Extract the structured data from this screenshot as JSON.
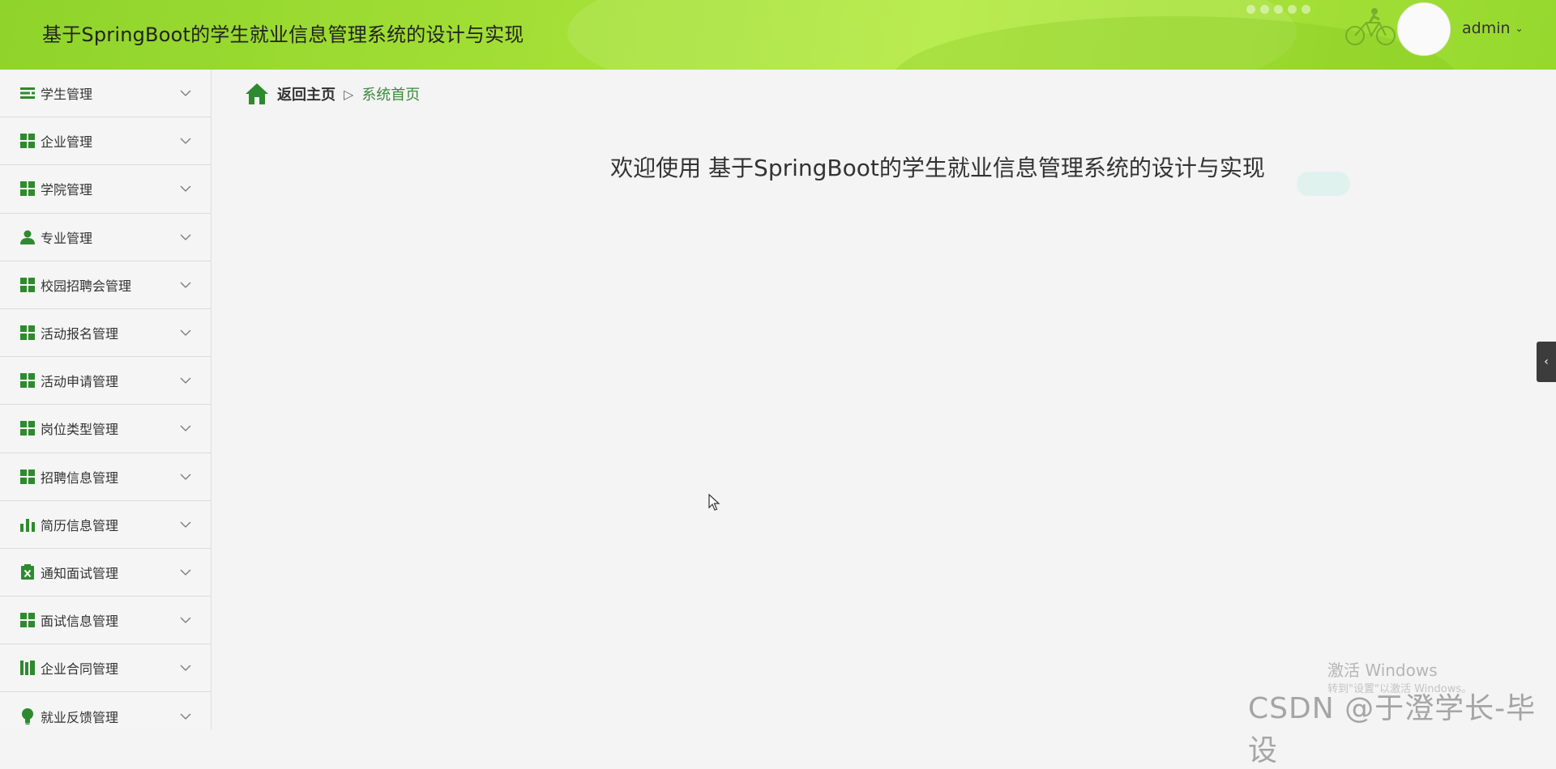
{
  "header": {
    "app_title": "基于SpringBoot的学生就业信息管理系统的设计与实现",
    "user_name": "admin",
    "caret": "⌄"
  },
  "sidebar": {
    "items": [
      {
        "label": "学生管理",
        "icon": "list-icon"
      },
      {
        "label": "企业管理",
        "icon": "grid-icon"
      },
      {
        "label": "学院管理",
        "icon": "grid-icon"
      },
      {
        "label": "专业管理",
        "icon": "user-icon"
      },
      {
        "label": "校园招聘会管理",
        "icon": "grid-icon"
      },
      {
        "label": "活动报名管理",
        "icon": "grid-icon"
      },
      {
        "label": "活动申请管理",
        "icon": "grid-icon"
      },
      {
        "label": "岗位类型管理",
        "icon": "grid-icon"
      },
      {
        "label": "招聘信息管理",
        "icon": "grid-icon"
      },
      {
        "label": "简历信息管理",
        "icon": "bar-chart-icon"
      },
      {
        "label": "通知面试管理",
        "icon": "clipboard-x-icon"
      },
      {
        "label": "面试信息管理",
        "icon": "grid-icon"
      },
      {
        "label": "企业合同管理",
        "icon": "book-icon"
      },
      {
        "label": "就业反馈管理",
        "icon": "bulb-icon"
      }
    ]
  },
  "breadcrumb": {
    "home": "返回主页",
    "separator": "▷",
    "current": "系统首页"
  },
  "main": {
    "welcome": "欢迎使用 基于SpringBoot的学生就业信息管理系统的设计与实现"
  },
  "collapse_tab": {
    "glyph": "‹"
  },
  "watermarks": {
    "windows_line1": "激活 Windows",
    "windows_line2": "转到\"设置\"以激活 Windows。",
    "csdn": "CSDN @于澄学长-毕设"
  },
  "colors": {
    "header_green": "#a3df36",
    "icon_green": "#2f8a2f",
    "breadcrumb_current": "#3a8a3a"
  }
}
